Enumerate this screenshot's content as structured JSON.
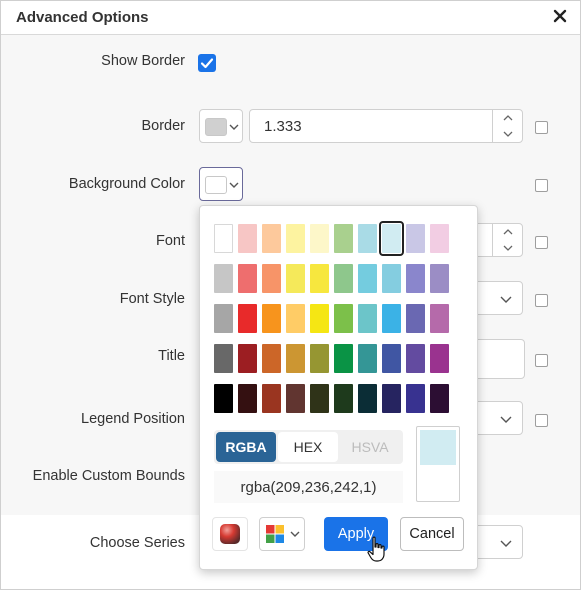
{
  "dialog": {
    "title": "Advanced Options",
    "close_icon": "close-icon"
  },
  "form": {
    "show_border_label": "Show Border",
    "show_border_checked": true,
    "border_label": "Border",
    "border_swatch_color": "#d0d0d0",
    "border_width_value": "1.333",
    "background_color_label": "Background Color",
    "background_swatch_color": "#ffffff",
    "font_label": "Font",
    "font_style_label": "Font Style",
    "title_label": "Title",
    "legend_position_label": "Legend Position",
    "enable_custom_bounds_label": "Enable Custom Bounds",
    "choose_series_label": "Choose Series"
  },
  "color_picker": {
    "palette": [
      [
        "#ffffff",
        "#f7c6c5",
        "#fdc99c",
        "#fdf3a0",
        "#fdf7c9",
        "#a9d08e",
        "#a9dbe6",
        "#d1ecf2",
        "#c9c7e6",
        "#f2cde3"
      ],
      [
        "#c6c6c6",
        "#ee6e6e",
        "#f79468",
        "#f5e95a",
        "#f7e73e",
        "#8ec78c",
        "#74ccdf",
        "#84cde0",
        "#8a86cc",
        "#9b8dc5"
      ],
      [
        "#a6a6a6",
        "#e82a2a",
        "#f7941d",
        "#ffcc66",
        "#f5e614",
        "#7cc04a",
        "#6cc5c9",
        "#3bb2e6",
        "#6a68b2",
        "#b56aaa"
      ],
      [
        "#686868",
        "#9c1e22",
        "#cc6628",
        "#cc9632",
        "#969632",
        "#0a9345",
        "#349696",
        "#4056a3",
        "#634ba0",
        "#9a338f"
      ],
      [
        "#000000",
        "#341011",
        "#9a3520",
        "#613530",
        "#2f3318",
        "#1e3a1c",
        "#0b2d36",
        "#262460",
        "#383290",
        "#2c0e33"
      ]
    ],
    "selected_color": "#d1ecf2",
    "modes": [
      "RGBA",
      "HEX",
      "HSVA"
    ],
    "active_mode": "RGBA",
    "value": "rgba(209,236,242,1)",
    "preview_new_color": "#d1ecf2",
    "preview_old_color": "#ffffff",
    "apply_label": "Apply",
    "cancel_label": "Cancel",
    "accent_color": "#1a73e8"
  }
}
